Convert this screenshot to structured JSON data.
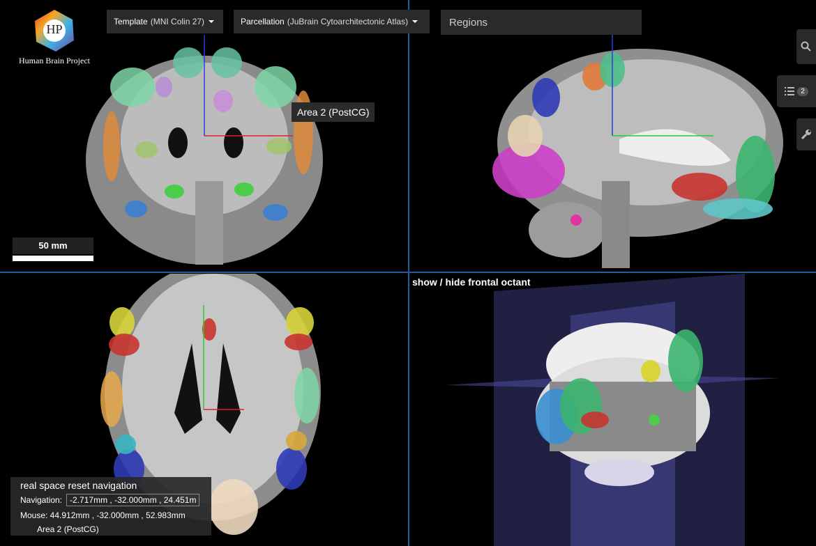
{
  "logo": {
    "mark": "HP",
    "name": "Human Brain Project"
  },
  "toolbar": {
    "template_label": "Template",
    "template_value": "(MNI Colin 27)",
    "parcellation_label": "Parcellation",
    "parcellation_value": "(JuBrain Cytoarchitectonic Atlas)",
    "regions_placeholder": "Regions"
  },
  "side_tools": {
    "search_icon": "search-icon",
    "list_icon": "list-icon",
    "list_count": "2",
    "wrench_icon": "wrench-icon"
  },
  "tooltip": "Area 2 (PostCG)",
  "scale_bar": {
    "label": "50 mm"
  },
  "octant_toggle": "show / hide frontal octant",
  "navigation": {
    "title": "real space reset navigation",
    "nav_label": "Navigation:",
    "nav_value": "-2.717mm , -32.000mm , 24.451m",
    "mouse_text": "Mouse: 44.912mm , -32.000mm , 52.983mm",
    "region": "Area 2 (PostCG)"
  },
  "colors": {
    "separator": "#1f5f9e",
    "panel_bg": "#000000",
    "control_bg": "#2a2a2a"
  }
}
